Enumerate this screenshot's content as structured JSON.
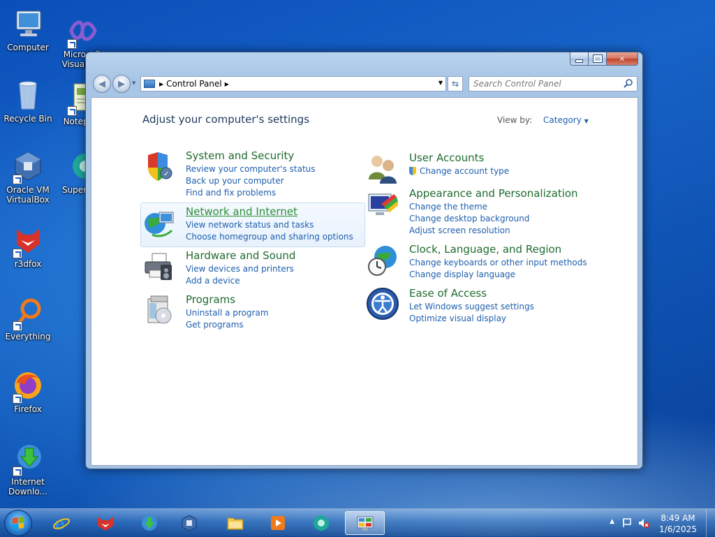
{
  "desktop": {
    "icons": [
      {
        "label": "Computer"
      },
      {
        "label": "Microsoft Visual S..."
      },
      {
        "label": "Recycle Bin"
      },
      {
        "label": "Notepa..."
      },
      {
        "label": "Oracle VM VirtualBox"
      },
      {
        "label": "Superm..."
      },
      {
        "label": "r3dfox"
      },
      {
        "label": "Everything"
      },
      {
        "label": "Firefox"
      },
      {
        "label": "Internet Downlo..."
      }
    ]
  },
  "window": {
    "breadcrumb": "Control Panel",
    "search_placeholder": "Search Control Panel",
    "heading": "Adjust your computer's settings",
    "view_by_label": "View by:",
    "view_by_value": "Category",
    "categories_left": [
      {
        "title": "System and Security",
        "links": [
          "Review your computer's status",
          "Back up your computer",
          "Find and fix problems"
        ]
      },
      {
        "title": "Network and Internet",
        "links": [
          "View network status and tasks",
          "Choose homegroup and sharing options"
        ]
      },
      {
        "title": "Hardware and Sound",
        "links": [
          "View devices and printers",
          "Add a device"
        ]
      },
      {
        "title": "Programs",
        "links": [
          "Uninstall a program",
          "Get programs"
        ]
      }
    ],
    "categories_right": [
      {
        "title": "User Accounts",
        "links": [
          "Change account type"
        ]
      },
      {
        "title": "Appearance and Personalization",
        "links": [
          "Change the theme",
          "Change desktop background",
          "Adjust screen resolution"
        ]
      },
      {
        "title": "Clock, Language, and Region",
        "links": [
          "Change keyboards or other input methods",
          "Change display language"
        ]
      },
      {
        "title": "Ease of Access",
        "links": [
          "Let Windows suggest settings",
          "Optimize visual display"
        ]
      }
    ]
  },
  "taskbar": {
    "time": "8:49 AM",
    "date": "1/6/2025",
    "pinned": [
      "internet-explorer",
      "r3dfox",
      "internet-download-manager",
      "virtualbox",
      "file-explorer",
      "media-player",
      "supermium",
      "control-panel"
    ]
  },
  "colors": {
    "link": "#1e5fae",
    "category_title": "#1e6b2f",
    "heading": "#1e395b"
  }
}
